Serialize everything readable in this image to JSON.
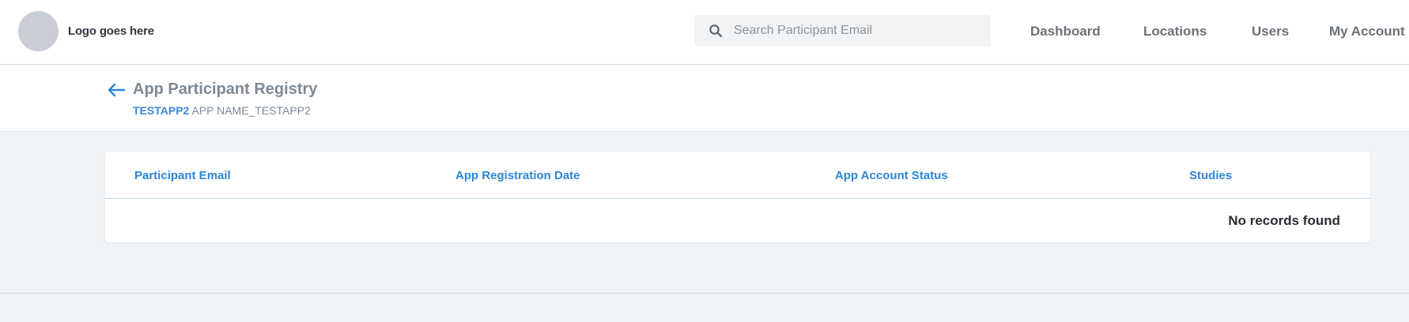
{
  "header": {
    "logo_text": "Logo goes here",
    "search": {
      "placeholder": "Search Participant Email",
      "value": ""
    },
    "nav": [
      "Dashboard",
      "Locations",
      "Users",
      "My Account"
    ]
  },
  "page": {
    "title": "App Participant Registry",
    "app_id": "TESTAPP2",
    "app_name": "APP NAME_TESTAPP2"
  },
  "table": {
    "columns": [
      "Participant Email",
      "App Registration Date",
      "App Account Status",
      "Studies"
    ],
    "rows": [],
    "empty_message": "No records found"
  },
  "colors": {
    "accent": "#2b86d8",
    "nav_text": "#6b7178",
    "title_text": "#7d8995",
    "background": "#f1f4f6"
  },
  "icons": {
    "search": "search-icon",
    "back": "back-arrow-icon",
    "logo": "logo-placeholder-icon"
  }
}
